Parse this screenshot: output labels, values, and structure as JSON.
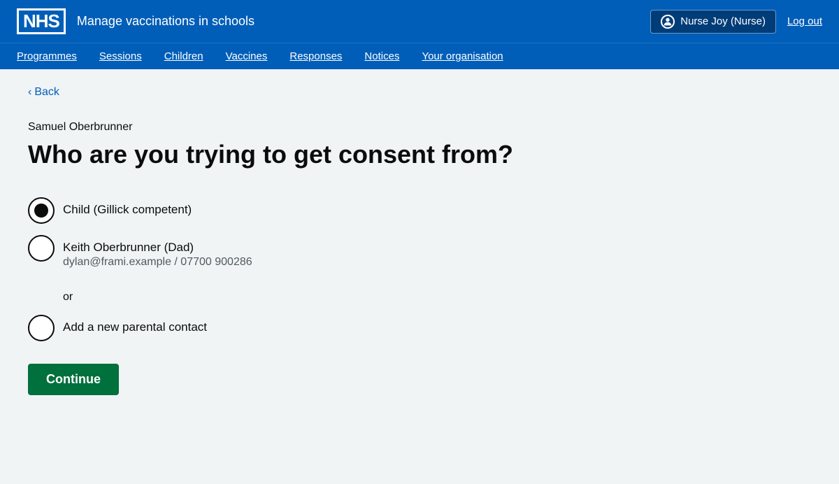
{
  "header": {
    "logo_text": "NHS",
    "app_title": "Manage vaccinations in schools",
    "user_name": "Nurse Joy (Nurse)",
    "logout_label": "Log out"
  },
  "nav": {
    "items": [
      {
        "label": "Programmes",
        "href": "#"
      },
      {
        "label": "Sessions",
        "href": "#"
      },
      {
        "label": "Children",
        "href": "#"
      },
      {
        "label": "Vaccines",
        "href": "#"
      },
      {
        "label": "Responses",
        "href": "#"
      },
      {
        "label": "Notices",
        "href": "#"
      },
      {
        "label": "Your organisation",
        "href": "#"
      }
    ]
  },
  "back": {
    "label": "Back"
  },
  "form": {
    "patient_name": "Samuel Oberbrunner",
    "heading": "Who are you trying to get consent from?",
    "options": [
      {
        "id": "child",
        "label": "Child (Gillick competent)",
        "sub_label": "",
        "selected": true
      },
      {
        "id": "parent",
        "label": "Keith Oberbrunner (Dad)",
        "sub_label": "dylan@frami.example / 07700 900286",
        "selected": false
      }
    ],
    "or_text": "or",
    "new_contact_option": {
      "id": "new",
      "label": "Add a new parental contact",
      "selected": false
    },
    "submit_label": "Continue"
  }
}
